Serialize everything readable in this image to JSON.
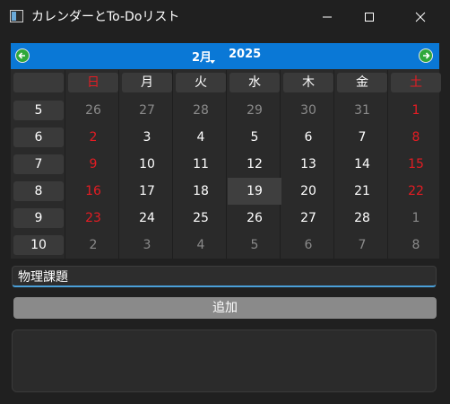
{
  "window": {
    "title": "カレンダーとTo-Doリスト"
  },
  "calendar": {
    "month_label": "2月",
    "year_label": "2025",
    "weekday_headers": [
      {
        "label": "日",
        "color": "#e51c23"
      },
      {
        "label": "月",
        "color": "#ffffff"
      },
      {
        "label": "火",
        "color": "#ffffff"
      },
      {
        "label": "水",
        "color": "#ffffff"
      },
      {
        "label": "木",
        "color": "#ffffff"
      },
      {
        "label": "金",
        "color": "#ffffff"
      },
      {
        "label": "土",
        "color": "#e51c23"
      }
    ],
    "weeks": [
      {
        "week": "5",
        "days": [
          {
            "d": "26",
            "other": true
          },
          {
            "d": "27",
            "other": true
          },
          {
            "d": "28",
            "other": true
          },
          {
            "d": "29",
            "other": true
          },
          {
            "d": "30",
            "other": true
          },
          {
            "d": "31",
            "other": true
          },
          {
            "d": "1",
            "other": false
          }
        ]
      },
      {
        "week": "6",
        "days": [
          {
            "d": "2",
            "other": false
          },
          {
            "d": "3",
            "other": false
          },
          {
            "d": "4",
            "other": false
          },
          {
            "d": "5",
            "other": false
          },
          {
            "d": "6",
            "other": false
          },
          {
            "d": "7",
            "other": false
          },
          {
            "d": "8",
            "other": false
          }
        ]
      },
      {
        "week": "7",
        "days": [
          {
            "d": "9",
            "other": false
          },
          {
            "d": "10",
            "other": false
          },
          {
            "d": "11",
            "other": false
          },
          {
            "d": "12",
            "other": false
          },
          {
            "d": "13",
            "other": false
          },
          {
            "d": "14",
            "other": false
          },
          {
            "d": "15",
            "other": false
          }
        ]
      },
      {
        "week": "8",
        "days": [
          {
            "d": "16",
            "other": false
          },
          {
            "d": "17",
            "other": false
          },
          {
            "d": "18",
            "other": false
          },
          {
            "d": "19",
            "other": false,
            "selected": true
          },
          {
            "d": "20",
            "other": false
          },
          {
            "d": "21",
            "other": false
          },
          {
            "d": "22",
            "other": false
          }
        ]
      },
      {
        "week": "9",
        "days": [
          {
            "d": "23",
            "other": false
          },
          {
            "d": "24",
            "other": false
          },
          {
            "d": "25",
            "other": false
          },
          {
            "d": "26",
            "other": false
          },
          {
            "d": "27",
            "other": false
          },
          {
            "d": "28",
            "other": false
          },
          {
            "d": "1",
            "other": true
          }
        ]
      },
      {
        "week": "10",
        "days": [
          {
            "d": "2",
            "other": true
          },
          {
            "d": "3",
            "other": true
          },
          {
            "d": "4",
            "other": true
          },
          {
            "d": "5",
            "other": true
          },
          {
            "d": "6",
            "other": true
          },
          {
            "d": "7",
            "other": true
          },
          {
            "d": "8",
            "other": true
          }
        ]
      }
    ],
    "colors": {
      "nav_bar": "#0a78d6",
      "weekend": "#e51c23",
      "other_month": "#8a8a8a"
    }
  },
  "todo": {
    "input_value": "物理課題",
    "add_button_label": "追加",
    "items": []
  },
  "icons": {
    "prev": "arrow-left-circle-icon",
    "next": "arrow-right-circle-icon",
    "minimize": "minimize-icon",
    "maximize": "maximize-icon",
    "close": "close-icon"
  }
}
